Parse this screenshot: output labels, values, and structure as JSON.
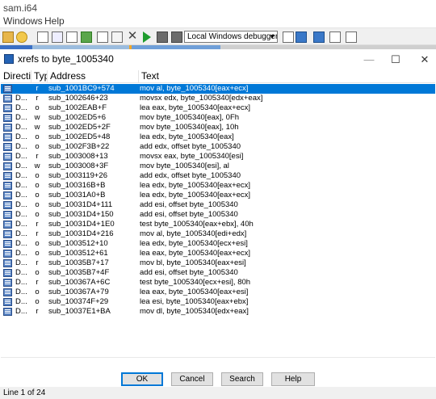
{
  "window": {
    "title": "sam.i64"
  },
  "menu": {
    "items": [
      "Windows",
      "Help"
    ]
  },
  "toolbar": {
    "debugger": "Local Windows debugger"
  },
  "dialog": {
    "title": "xrefs to byte_1005340",
    "controls": {
      "minimize": "—",
      "maximize": "☐",
      "close": "✕"
    },
    "columns": {
      "direction": "Directio",
      "type": "Typ",
      "address": "Address",
      "text": "Text"
    },
    "rows": [
      {
        "dir": "",
        "type": "r",
        "addr": "sub_1001BC9+574",
        "text": "mov    al, byte_1005340[eax+ecx]"
      },
      {
        "dir": "D...",
        "type": "r",
        "addr": "sub_1002646+23",
        "text": "movsx  edx, byte_1005340[edx+eax]"
      },
      {
        "dir": "D...",
        "type": "o",
        "addr": "sub_1002EAB+F",
        "text": "lea    eax, byte_1005340[eax+ecx]"
      },
      {
        "dir": "D...",
        "type": "w",
        "addr": "sub_1002ED5+6",
        "text": "mov    byte_1005340[eax], 0Fh"
      },
      {
        "dir": "D...",
        "type": "w",
        "addr": "sub_1002ED5+2F",
        "text": "mov    byte_1005340[eax], 10h"
      },
      {
        "dir": "D...",
        "type": "o",
        "addr": "sub_1002ED5+48",
        "text": "lea    edx, byte_1005340[eax]"
      },
      {
        "dir": "D...",
        "type": "o",
        "addr": "sub_1002F3B+22",
        "text": "add    edx, offset byte_1005340"
      },
      {
        "dir": "D...",
        "type": "r",
        "addr": "sub_1003008+13",
        "text": "movsx  eax, byte_1005340[esi]"
      },
      {
        "dir": "D...",
        "type": "w",
        "addr": "sub_1003008+3F",
        "text": "mov    byte_1005340[esi], al"
      },
      {
        "dir": "D...",
        "type": "o",
        "addr": "sub_1003119+26",
        "text": "add    edx, offset byte_1005340"
      },
      {
        "dir": "D...",
        "type": "o",
        "addr": "sub_100316B+B",
        "text": "lea    edx, byte_1005340[eax+ecx]"
      },
      {
        "dir": "D...",
        "type": "o",
        "addr": "sub_10031A0+B",
        "text": "lea    edx, byte_1005340[eax+ecx]"
      },
      {
        "dir": "D...",
        "type": "o",
        "addr": "sub_10031D4+111",
        "text": "add    esi, offset byte_1005340"
      },
      {
        "dir": "D...",
        "type": "o",
        "addr": "sub_10031D4+150",
        "text": "add    esi, offset byte_1005340"
      },
      {
        "dir": "D...",
        "type": "r",
        "addr": "sub_10031D4+1E0",
        "text": "test   byte_1005340[eax+ebx], 40h"
      },
      {
        "dir": "D...",
        "type": "r",
        "addr": "sub_10031D4+216",
        "text": "mov    al, byte_1005340[edi+edx]"
      },
      {
        "dir": "D...",
        "type": "o",
        "addr": "sub_1003512+10",
        "text": "lea    edx, byte_1005340[ecx+esi]"
      },
      {
        "dir": "D...",
        "type": "o",
        "addr": "sub_1003512+61",
        "text": "lea    eax, byte_1005340[eax+ecx]"
      },
      {
        "dir": "D...",
        "type": "r",
        "addr": "sub_10035B7+17",
        "text": "mov    bl, byte_1005340[eax+esi]"
      },
      {
        "dir": "D...",
        "type": "o",
        "addr": "sub_10035B7+4F",
        "text": "add    esi, offset byte_1005340"
      },
      {
        "dir": "D...",
        "type": "r",
        "addr": "sub_100367A+6C",
        "text": "test   byte_1005340[ecx+esi], 80h"
      },
      {
        "dir": "D...",
        "type": "o",
        "addr": "sub_100367A+79",
        "text": "lea    eax, byte_1005340[eax+esi]"
      },
      {
        "dir": "D...",
        "type": "o",
        "addr": "sub_100374F+29",
        "text": "lea    esi, byte_1005340[eax+ebx]"
      },
      {
        "dir": "D...",
        "type": "r",
        "addr": "sub_10037E1+BA",
        "text": "mov    dl, byte_1005340[edx+eax]"
      }
    ],
    "buttons": {
      "ok": "OK",
      "cancel": "Cancel",
      "search": "Search",
      "help": "Help"
    },
    "status": "Line 1 of 24"
  },
  "colors": {
    "selection": "#0078d7",
    "accent": "#2463b5"
  },
  "icons": [
    "open-folder-icon",
    "graph-view-icon",
    "cross-icon",
    "play-icon",
    "pause-icon",
    "stop-icon",
    "xref-icon"
  ]
}
